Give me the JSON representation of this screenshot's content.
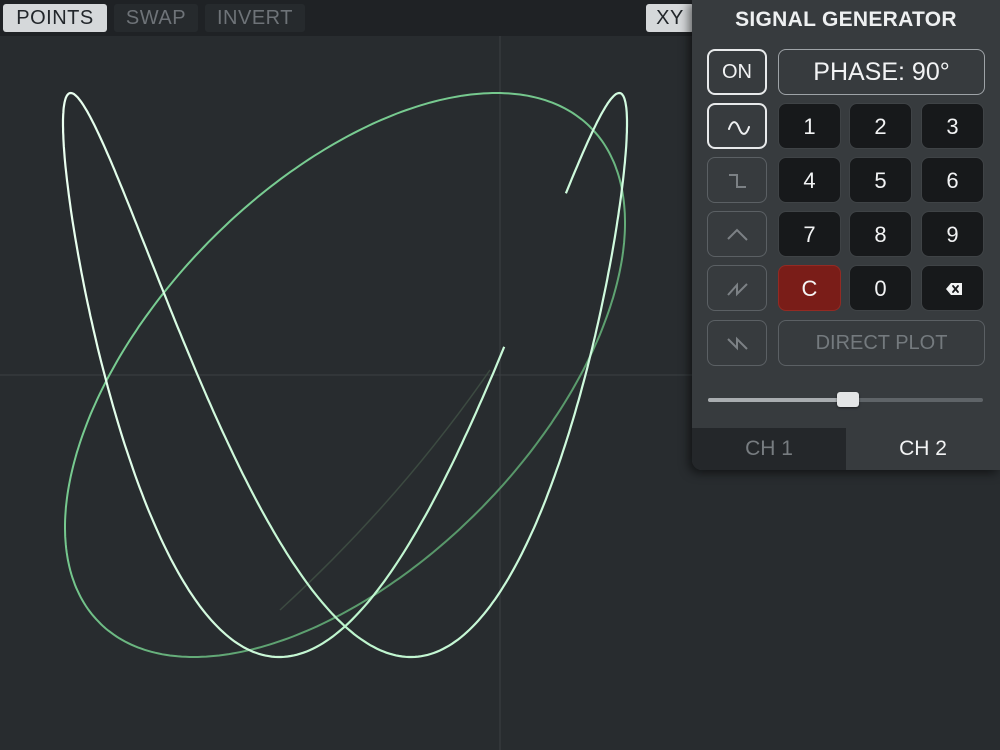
{
  "toolbar": {
    "points_label": "POINTS",
    "swap_label": "SWAP",
    "invert_label": "INVERT",
    "xy_label": "XY"
  },
  "panel": {
    "title": "SIGNAL GENERATOR",
    "on_label": "ON",
    "phase_label": "PHASE: 90°",
    "waveforms": [
      "sine-wave-icon",
      "square-wave-icon",
      "triangle-wave-icon",
      "sawtooth-wave-icon",
      "reverse-sawtooth-wave-icon"
    ],
    "keypad": [
      "1",
      "2",
      "3",
      "4",
      "5",
      "6",
      "7",
      "8",
      "9"
    ],
    "clear_label": "C",
    "zero_label": "0",
    "backspace_icon": "backspace-icon",
    "direct_plot_label": "DIRECT PLOT",
    "slider_value": 0.51,
    "tabs": [
      "CH 1",
      "CH 2"
    ],
    "active_tab": "CH 2"
  },
  "colors": {
    "trace_bright": "#d8fbe3",
    "trace_green": "#82d99a",
    "clear_key": "#7a1d18",
    "panel_bg": "#373b3e",
    "scope_bg": "#282c2f"
  }
}
